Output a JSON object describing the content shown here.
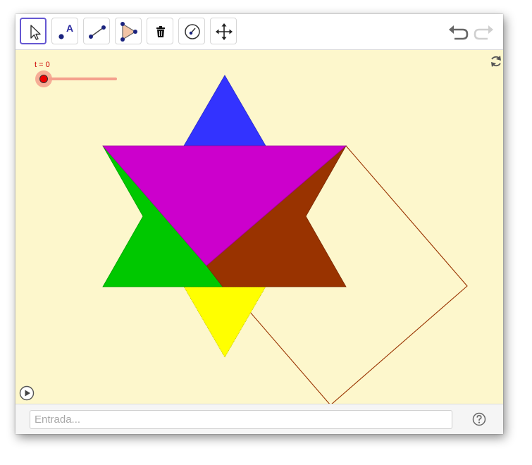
{
  "toolbar": {
    "tools": [
      {
        "name": "move-tool",
        "icon": "cursor-arrow-icon",
        "active": true
      },
      {
        "name": "point-tool",
        "icon": "point-icon",
        "active": false
      },
      {
        "name": "segment-tool",
        "icon": "segment-icon",
        "active": false
      },
      {
        "name": "polygon-tool",
        "icon": "polygon-icon",
        "active": false
      },
      {
        "name": "delete-tool",
        "icon": "trash-icon",
        "active": false
      },
      {
        "name": "slider-tool",
        "icon": "angle-slider-icon",
        "active": false
      },
      {
        "name": "move-view-tool",
        "icon": "move-arrows-icon",
        "active": false
      }
    ],
    "point_tool_letter": "A",
    "undo_icon": "undo-icon",
    "redo_icon": "redo-icon"
  },
  "graphics": {
    "background": "#fdf7cc",
    "slider": {
      "label": "t = 0",
      "value": 0,
      "color": "#cc0000"
    },
    "shape_colors": {
      "top_triangle": "#3333ff",
      "bottom_triangle": "#ffff00",
      "left_piece": "#00c800",
      "right_piece": "#993300",
      "center_triangle": "#cc00cc",
      "square_outline": "#993300"
    }
  },
  "input_bar": {
    "placeholder": "Entrada...",
    "value": "",
    "help_icon": "help-question-icon"
  }
}
